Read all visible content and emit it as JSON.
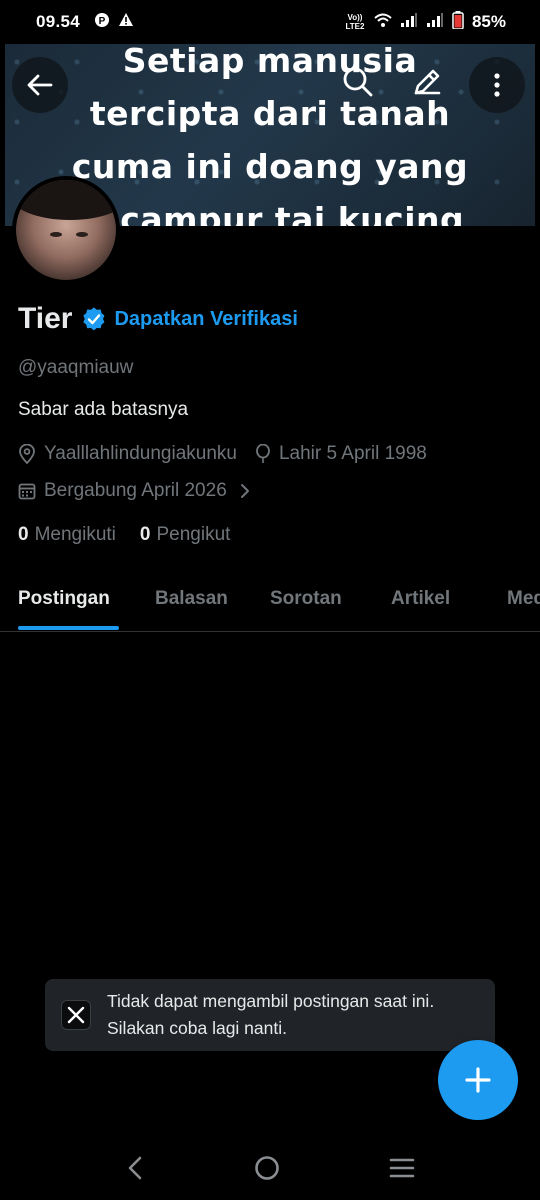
{
  "status_bar": {
    "time": "09.54",
    "network_label": "Vo)) LTE2",
    "battery": "85%"
  },
  "banner": {
    "lines": [
      "Setiap manusia",
      "tercipta dari tanah",
      "cuma ini doang yang",
      "kecampur tai kucing"
    ]
  },
  "profile": {
    "name": "Tier",
    "verify_link": "Dapatkan Verifikasi",
    "handle": "@yaaqmiauw",
    "bio": "Sabar ada batasnya",
    "location": "Yaalllahlindungiakunku",
    "birth": "Lahir 5 April 1998",
    "joined": "Bergabung April 2026",
    "following_count": "0",
    "following_label": "Mengikuti",
    "followers_count": "0",
    "followers_label": "Pengikut"
  },
  "tabs": [
    {
      "label": "Postingan",
      "active": true
    },
    {
      "label": "Balasan",
      "active": false
    },
    {
      "label": "Sorotan",
      "active": false
    },
    {
      "label": "Artikel",
      "active": false
    },
    {
      "label": "Media",
      "active": false
    }
  ],
  "toast": {
    "line1": "Tidak dapat mengambil postingan saat ini.",
    "line2": "Silakan coba lagi nanti."
  },
  "colors": {
    "accent": "#1d9bf0",
    "background": "#000000",
    "secondary_text": "#71767b",
    "primary_text": "#e7e9ea"
  },
  "icons": [
    "back-arrow-icon",
    "search-icon",
    "edit-icon",
    "more-vertical-icon",
    "verified-badge-icon",
    "location-icon",
    "balloon-icon",
    "calendar-icon",
    "chevron-right-icon",
    "x-logo-icon",
    "plus-icon",
    "nav-back-icon",
    "nav-home-icon",
    "nav-recents-icon"
  ]
}
